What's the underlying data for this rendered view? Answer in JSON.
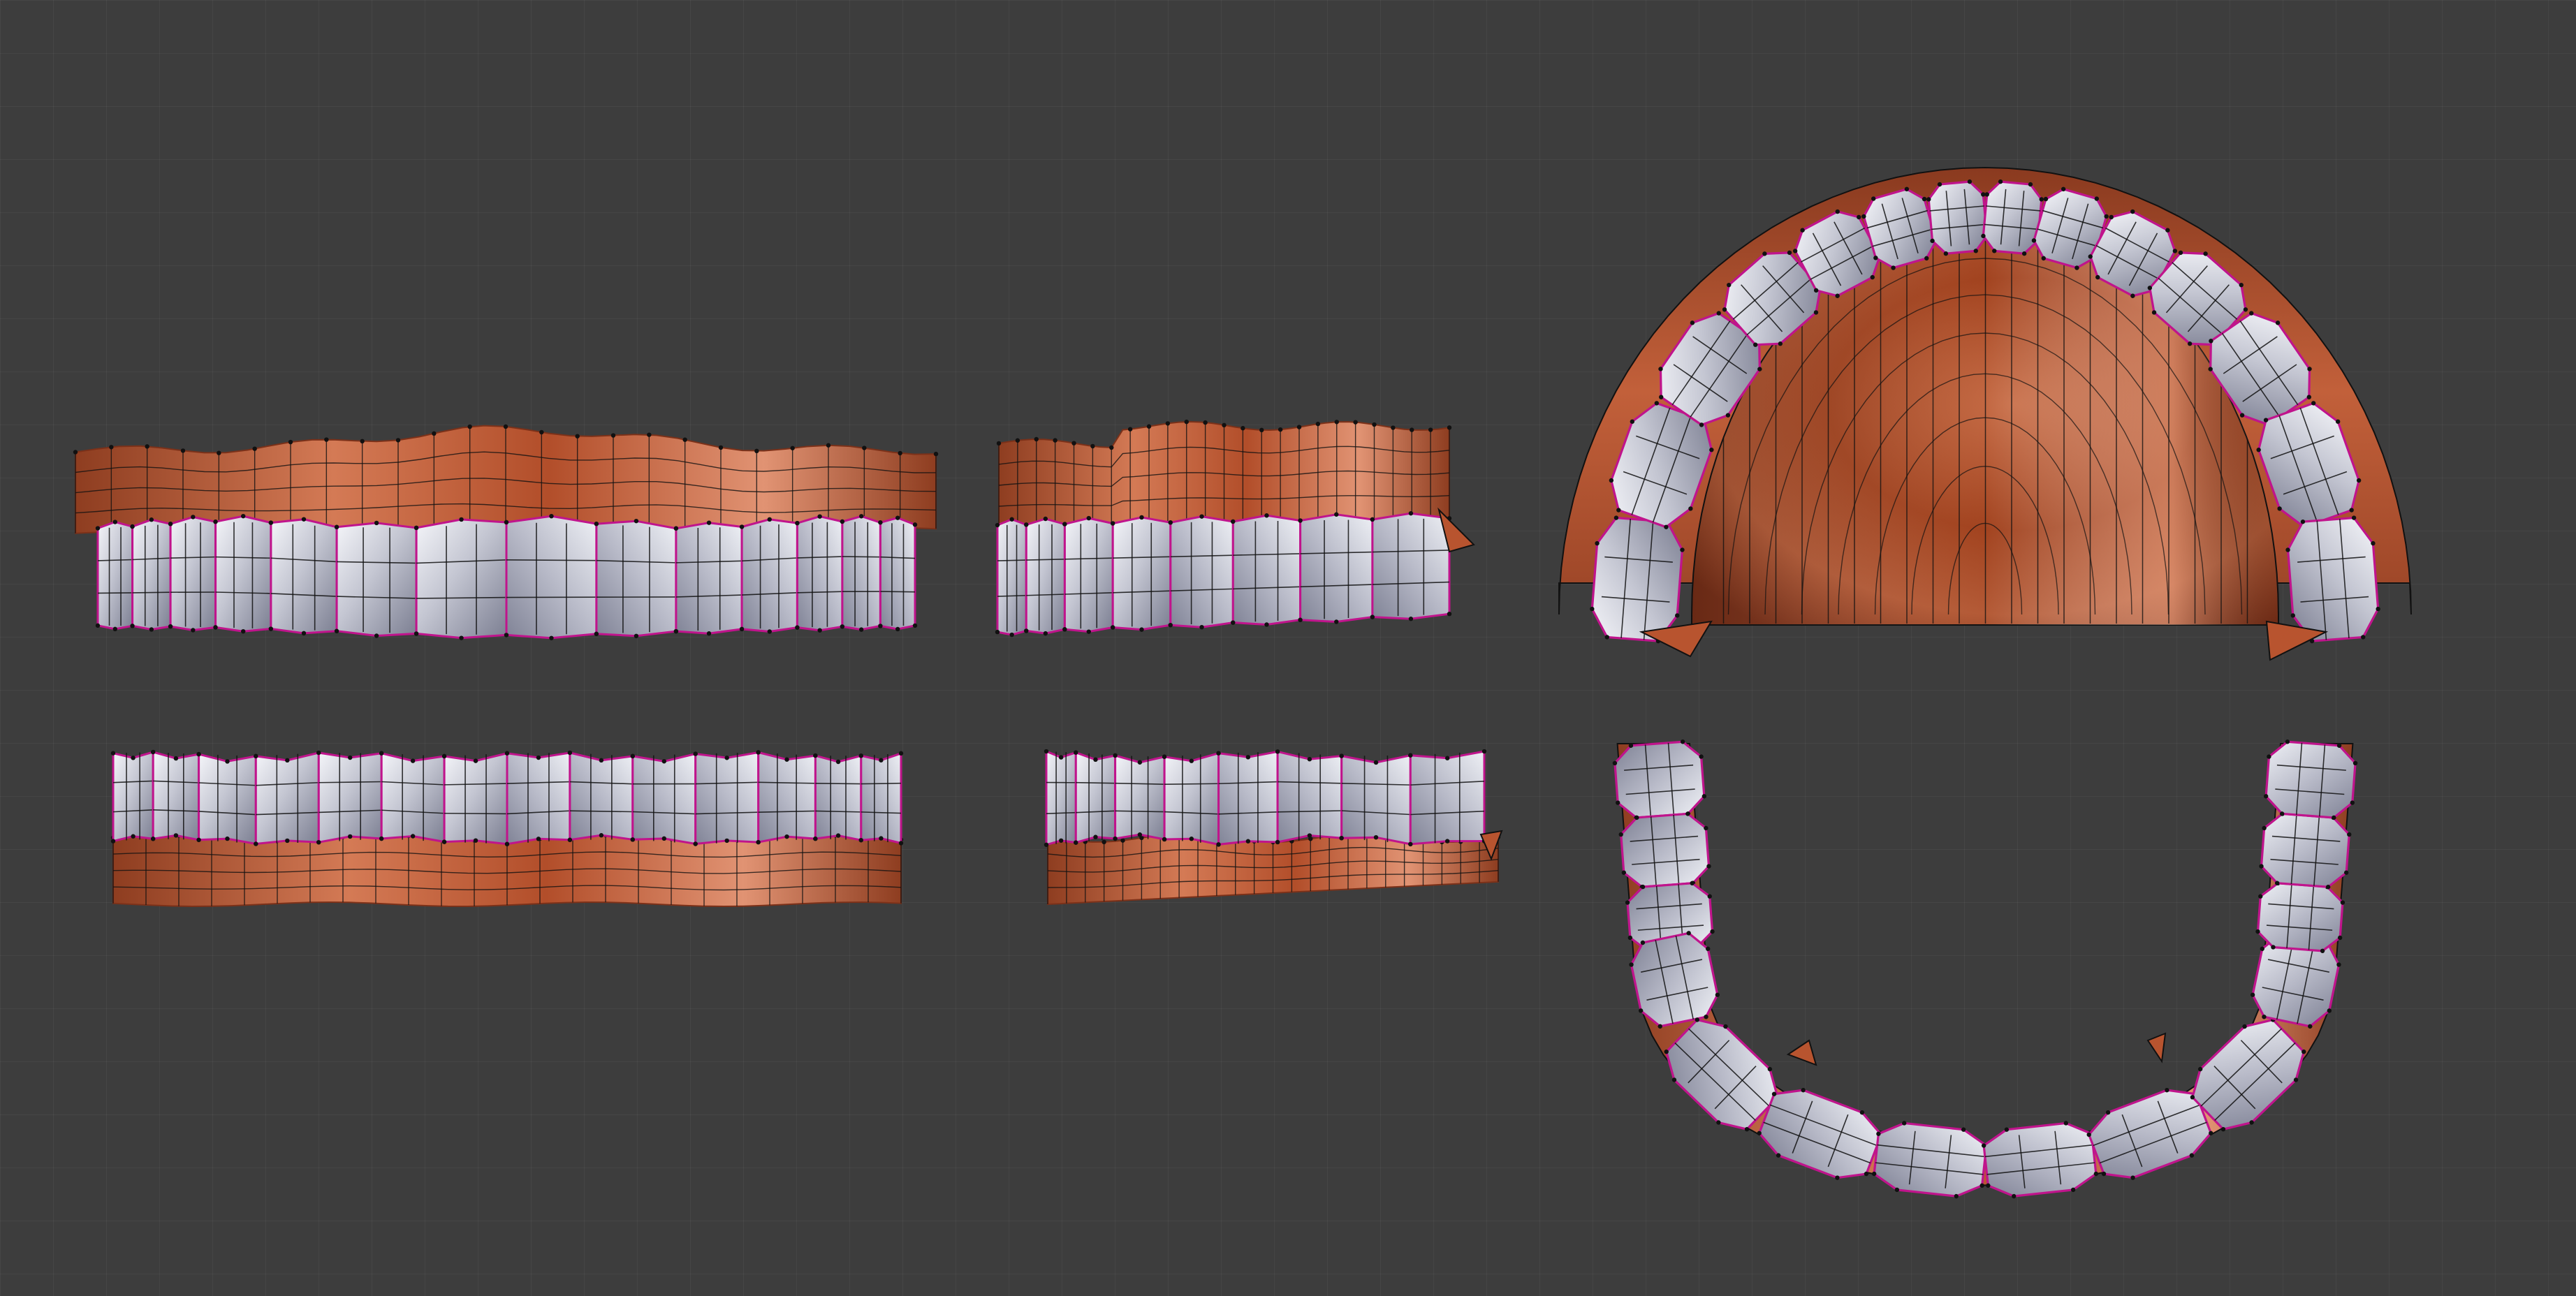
{
  "viewport": {
    "background": "#3d3d3d",
    "grid_line": "rgba(255,255,255,0.045)"
  },
  "colors": {
    "gum": "#b8542f",
    "gum_light": "#e79676",
    "gum_dark": "#7c3119",
    "tooth": "#c9cbd6",
    "tooth_light": "#f3f4f8",
    "tooth_dark": "#7e8193",
    "edge": "#111111",
    "seam": "#c0148c"
  },
  "models": [
    {
      "name": "upper-teeth-front-view",
      "tooth_count": 14
    },
    {
      "name": "upper-teeth-side-view",
      "tooth_count": 8
    },
    {
      "name": "upper-teeth-bottom-view",
      "tooth_count": 14
    },
    {
      "name": "lower-teeth-front-view",
      "tooth_count": 14
    },
    {
      "name": "lower-teeth-side-view",
      "tooth_count": 8
    },
    {
      "name": "lower-teeth-top-view",
      "tooth_count": 14
    }
  ]
}
